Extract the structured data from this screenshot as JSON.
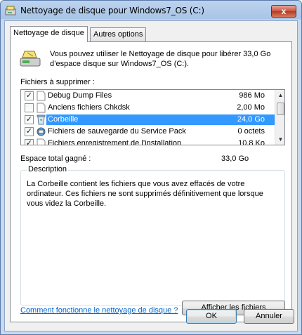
{
  "window": {
    "title": "Nettoyage de disque pour Windows7_OS (C:)",
    "close_label": "x"
  },
  "tabs": [
    {
      "label": "Nettoyage de disque",
      "active": true
    },
    {
      "label": "Autres options",
      "active": false
    }
  ],
  "intro": {
    "text": "Vous pouvez utiliser le Nettoyage de disque pour libérer 33,0 Go d’espace disque sur Windows7_OS (C:)."
  },
  "files": {
    "label": "Fichiers à supprimer :",
    "items": [
      {
        "label": "Debug Dump Files",
        "size": "986 Mo",
        "checked": true,
        "selected": false,
        "icon": "file-icon"
      },
      {
        "label": "Anciens fichiers Chkdsk",
        "size": "2,00 Mo",
        "checked": false,
        "selected": false,
        "icon": "file-icon"
      },
      {
        "label": "Corbeille",
        "size": "24,0 Go",
        "checked": true,
        "selected": true,
        "icon": "recycle-bin-icon"
      },
      {
        "label": "Fichiers de sauvegarde du Service Pack",
        "size": "0 octets",
        "checked": true,
        "selected": false,
        "icon": "service-pack-icon"
      },
      {
        "label": "Fichiers enregistrement de l’installation",
        "size": "10,8 Ko",
        "checked": true,
        "selected": false,
        "icon": "file-icon"
      }
    ]
  },
  "gain": {
    "label": "Espace total gagné :",
    "value": "33,0 Go"
  },
  "description": {
    "title": "Description",
    "text": "La Corbeille contient les fichiers que vous avez effacés de votre ordinateur. Ces fichiers ne sont supprimés définitivement que lorsque vous videz la Corbeille.",
    "button_label": "Afficher les fichiers"
  },
  "help_link": "Comment fonctionne le nettoyage de disque ?",
  "buttons": {
    "ok": "OK",
    "cancel": "Annuler"
  },
  "colors": {
    "selection": "#3399ff",
    "link": "#0066cc"
  }
}
